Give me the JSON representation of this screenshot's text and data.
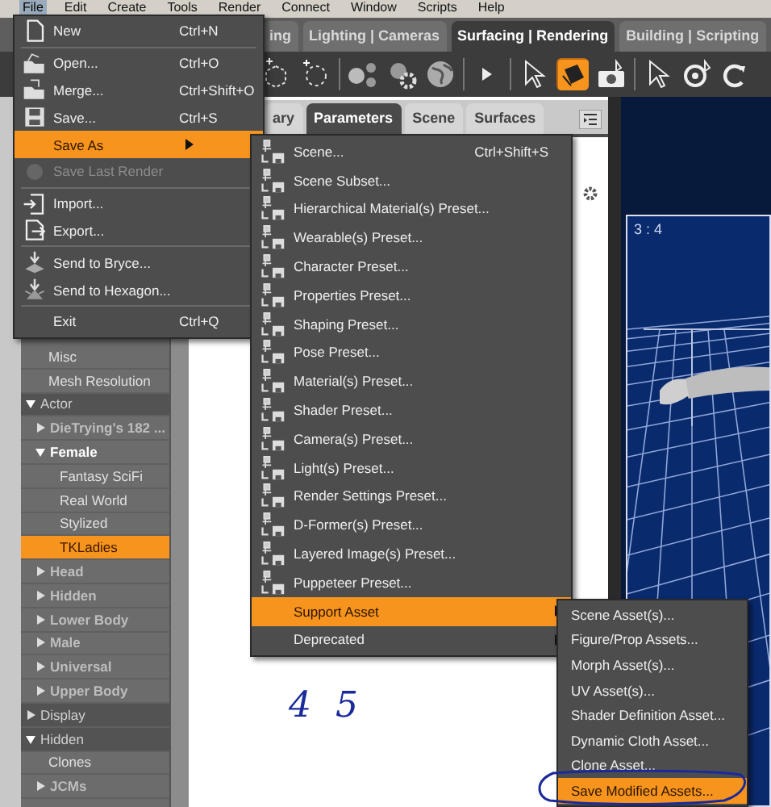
{
  "menubar": [
    {
      "label": "File",
      "selected": true
    },
    {
      "label": "Edit",
      "selected": false
    },
    {
      "label": "Create",
      "selected": false
    },
    {
      "label": "Tools",
      "selected": false
    },
    {
      "label": "Render",
      "selected": false
    },
    {
      "label": "Connect",
      "selected": false
    },
    {
      "label": "Window",
      "selected": false
    },
    {
      "label": "Scripts",
      "selected": false
    },
    {
      "label": "Help",
      "selected": false
    }
  ],
  "room_tabs": [
    {
      "label": "ing",
      "selected": false
    },
    {
      "label": "Lighting | Cameras",
      "selected": false
    },
    {
      "label": "Surfacing | Rendering",
      "selected": true
    },
    {
      "label": "Building | Scripting",
      "selected": false
    }
  ],
  "toolbar_tools": [
    {
      "selected": false
    },
    {
      "selected": false
    },
    {
      "selected": false
    },
    {
      "selected": false
    },
    {
      "selected": false
    },
    {
      "selected": false
    },
    {
      "selected": false
    },
    {
      "selected": true
    },
    {
      "selected": false
    },
    {
      "selected": false
    },
    {
      "selected": false
    },
    {
      "selected": false
    }
  ],
  "tree": [
    {
      "children": [
        {
          "label": "Misc"
        },
        {
          "label": "Mesh Resolution"
        }
      ]
    },
    {
      "label": "Actor",
      "expanded": true,
      "children": [
        {
          "label": "DieTrying's 182 ...",
          "expanded": false
        },
        {
          "label": "Female",
          "expanded": true,
          "children": [
            {
              "label": "Fantasy SciFi",
              "selected": false
            },
            {
              "label": "Real World",
              "selected": false
            },
            {
              "label": "Stylized",
              "selected": false
            },
            {
              "label": "TKLadies",
              "selected": true
            }
          ]
        },
        {
          "label": "Head",
          "expanded": false
        },
        {
          "label": "Hidden",
          "expanded": false
        },
        {
          "label": "Lower Body",
          "expanded": false
        },
        {
          "label": "Male",
          "expanded": false
        },
        {
          "label": "Universal",
          "expanded": false
        },
        {
          "label": "Upper Body",
          "expanded": false
        }
      ]
    },
    {
      "label": "Display",
      "expanded": false
    },
    {
      "label": "Hidden",
      "expanded": true,
      "children": [
        {
          "label": "Clones"
        },
        {
          "label": "JCMs",
          "expanded": false
        }
      ]
    }
  ],
  "pane_tabs": [
    {
      "label": "ary",
      "selected": false
    },
    {
      "label": "Parameters",
      "selected": true
    },
    {
      "label": "Scene",
      "selected": false
    },
    {
      "label": "Surfaces",
      "selected": false
    }
  ],
  "viewport": {
    "label": "3 : 4"
  },
  "handwriting": "4 5",
  "file_menu": [
    {
      "kind": "item",
      "label": "New",
      "shortcut": "Ctrl+N",
      "selected": false,
      "disabled": false
    },
    {
      "kind": "separator"
    },
    {
      "kind": "item",
      "label": "Open...",
      "shortcut": "Ctrl+O",
      "selected": false,
      "disabled": false
    },
    {
      "kind": "item",
      "label": "Merge...",
      "shortcut": "Ctrl+Shift+O",
      "selected": false,
      "disabled": false
    },
    {
      "kind": "item",
      "label": "Save...",
      "shortcut": "Ctrl+S",
      "selected": false,
      "disabled": false
    },
    {
      "kind": "item",
      "label": "Save As",
      "selected": true,
      "disabled": false,
      "submenu": true
    },
    {
      "kind": "item",
      "label": "Save Last Render",
      "selected": false,
      "disabled": true
    },
    {
      "kind": "separator"
    },
    {
      "kind": "item",
      "label": "Import...",
      "selected": false,
      "disabled": false
    },
    {
      "kind": "item",
      "label": "Export...",
      "selected": false,
      "disabled": false
    },
    {
      "kind": "separator"
    },
    {
      "kind": "item",
      "label": "Send to Bryce...",
      "selected": false,
      "disabled": false
    },
    {
      "kind": "item",
      "label": "Send to Hexagon...",
      "selected": false,
      "disabled": false
    },
    {
      "kind": "separator"
    },
    {
      "kind": "item",
      "label": "Exit",
      "shortcut": "Ctrl+Q",
      "selected": false,
      "disabled": false
    }
  ],
  "save_as_menu": [
    {
      "label": "Scene...",
      "shortcut": "Ctrl+Shift+S",
      "selected": false
    },
    {
      "label": "Scene Subset...",
      "selected": false
    },
    {
      "label": "Hierarchical Material(s) Preset...",
      "selected": false
    },
    {
      "label": "Wearable(s) Preset...",
      "selected": false
    },
    {
      "label": "Character Preset...",
      "selected": false
    },
    {
      "label": "Properties Preset...",
      "selected": false
    },
    {
      "label": "Shaping Preset...",
      "selected": false
    },
    {
      "label": "Pose Preset...",
      "selected": false
    },
    {
      "label": "Material(s) Preset...",
      "selected": false
    },
    {
      "label": "Shader Preset...",
      "selected": false
    },
    {
      "label": "Camera(s) Preset...",
      "selected": false
    },
    {
      "label": "Light(s) Preset...",
      "selected": false
    },
    {
      "label": "Render Settings Preset...",
      "selected": false
    },
    {
      "label": "D-Former(s) Preset...",
      "selected": false
    },
    {
      "label": "Layered Image(s) Preset...",
      "selected": false
    },
    {
      "label": "Puppeteer Preset...",
      "selected": false
    },
    {
      "label": "Support Asset",
      "selected": true,
      "submenu": true
    },
    {
      "label": "Deprecated",
      "selected": false,
      "submenu": true
    }
  ],
  "support_asset_menu": [
    {
      "label": "Scene Asset(s)...",
      "selected": false
    },
    {
      "label": "Figure/Prop Assets...",
      "selected": false
    },
    {
      "label": "Morph Asset(s)...",
      "selected": false
    },
    {
      "label": "UV Asset(s)...",
      "selected": false
    },
    {
      "label": "Shader Definition Asset...",
      "selected": false
    },
    {
      "label": "Dynamic Cloth Asset...",
      "selected": false
    },
    {
      "label": "Clone Asset...",
      "selected": false
    },
    {
      "label": "Save Modified Assets...",
      "selected": true
    }
  ]
}
